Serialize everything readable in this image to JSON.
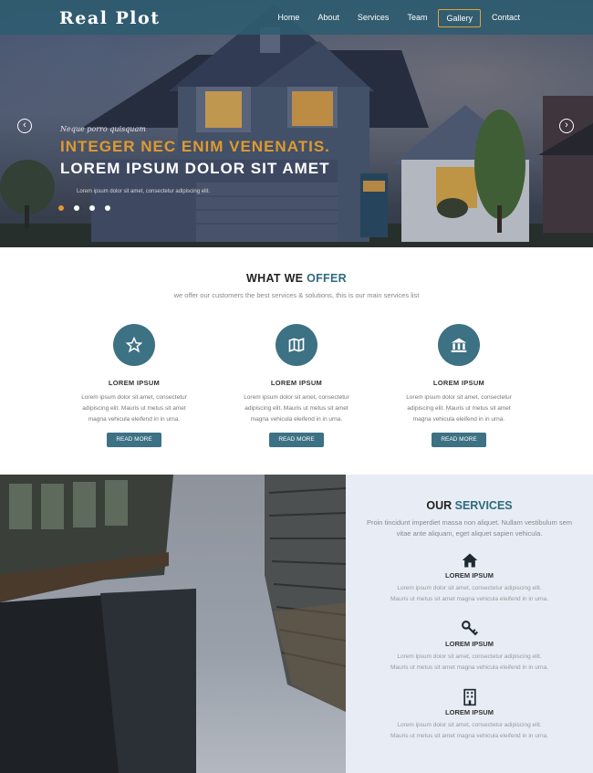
{
  "brand": {
    "name": "Real Plot"
  },
  "nav": {
    "items": [
      {
        "label": "Home"
      },
      {
        "label": "About"
      },
      {
        "label": "Services"
      },
      {
        "label": "Team"
      },
      {
        "label": "Gallery",
        "active": true
      },
      {
        "label": "Contact"
      }
    ]
  },
  "hero": {
    "kicker": "Neque porro quisquam",
    "title": "INTEGER NEC ENIM VENENATIS.",
    "subtitle": "LOREM IPSUM DOLOR SIT AMET",
    "text": "Lorem ipsum dolor sit amet, consectetur adipiscing elit.",
    "slides": 4,
    "active_slide": 1,
    "prev_icon": "chevron-left-icon",
    "next_icon": "chevron-right-icon"
  },
  "offer": {
    "title_prefix": "WHAT WE ",
    "title_accent": "OFFER",
    "subtitle": "we offer our customers the best services & solutions, this is our main services list",
    "cards": [
      {
        "icon": "star-icon",
        "title": "LOREM IPSUM",
        "text_lines": [
          "Lorem ipsum dolor sit amet, consectetur",
          "adipiscing elit. Mauris ut metus sit amet",
          "magna vehicula eleifend in in urna."
        ],
        "button": "READ MORE"
      },
      {
        "icon": "map-icon",
        "title": "LOREM IPSUM",
        "text_lines": [
          "Lorem ipsum dolor sit amet, consectetur",
          "adipiscing elit. Mauris ut metus sit amet",
          "magna vehicula eleifend in in urna."
        ],
        "button": "READ MORE"
      },
      {
        "icon": "bank-icon",
        "title": "LOREM IPSUM",
        "text_lines": [
          "Lorem ipsum dolor sit amet, consectetur",
          "adipiscing elit. Mauris ut metus sit amet",
          "magna vehicula eleifend in in urna."
        ],
        "button": "READ MORE"
      }
    ]
  },
  "services": {
    "title_prefix": "OUR ",
    "title_accent": "SERVICES",
    "subtitle": "Proin tincidunt imperdiet massa non aliquet. Nullam vestibulum sem vitae ante aliquam, eget aliquet sapien vehicula.",
    "items": [
      {
        "icon": "home-icon",
        "title": "LOREM IPSUM",
        "text_lines": [
          "Lorem ipsum dolor sit amet, consectetur adipiscing elit.",
          "Mauris ut metus sit amet magna vehicula eleifend in in urna."
        ]
      },
      {
        "icon": "key-icon",
        "title": "LOREM IPSUM",
        "text_lines": [
          "Lorem ipsum dolor sit amet, consectetur adipiscing elit.",
          "Mauris ut metus sit amet magna vehicula eleifend in in urna."
        ]
      },
      {
        "icon": "building-icon",
        "title": "LOREM IPSUM",
        "text_lines": [
          "Lorem ipsum dolor sit amet, consectetur adipiscing elit.",
          "Mauris ut metus sit amet magna vehicula eleifend in in urna."
        ]
      }
    ]
  },
  "colors": {
    "accent": "#2e6a7e",
    "hero_title": "#e09a2e",
    "navbar": "#2e5c70",
    "icon_bg": "#3d7184"
  }
}
